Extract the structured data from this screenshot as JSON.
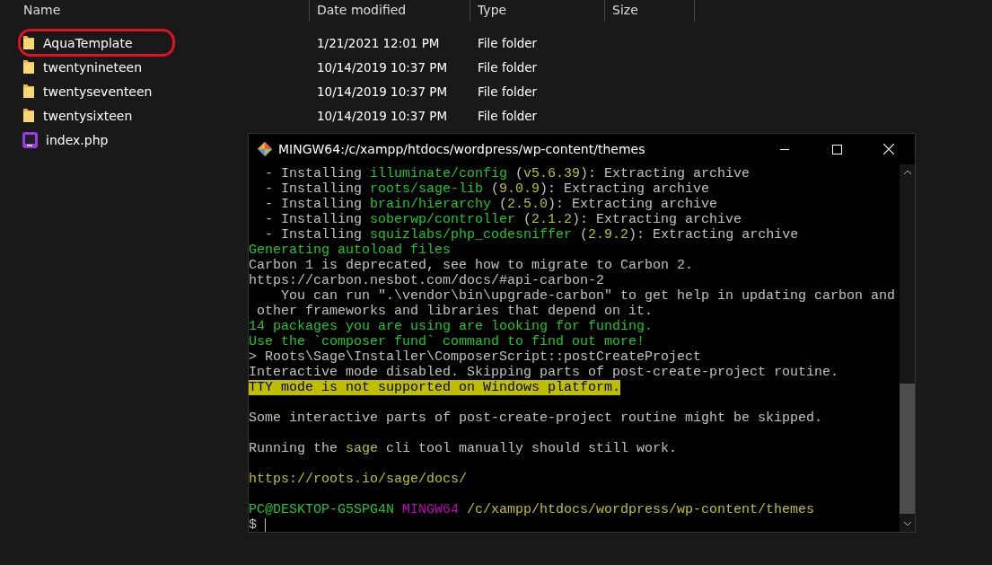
{
  "explorer": {
    "columns": [
      "Name",
      "Date modified",
      "Type",
      "Size"
    ],
    "rows": [
      {
        "name": "AquaTemplate",
        "date": "1/21/2021 12:01 PM",
        "type": "File folder",
        "kind": "folder",
        "circled": true
      },
      {
        "name": "twentynineteen",
        "date": "10/14/2019 10:37 PM",
        "type": "File folder",
        "kind": "folder",
        "circled": false
      },
      {
        "name": "twentyseventeen",
        "date": "10/14/2019 10:37 PM",
        "type": "File folder",
        "kind": "folder",
        "circled": false
      },
      {
        "name": "twentysixteen",
        "date": "10/14/2019 10:37 PM",
        "type": "File folder",
        "kind": "folder",
        "circled": false
      },
      {
        "name": "index.php",
        "kind": "php",
        "circled": false
      }
    ]
  },
  "terminal": {
    "title": "MINGW64:/c/xampp/htdocs/wordpress/wp-content/themes",
    "lines": [
      {
        "kind": "text",
        "segments": [
          {
            "kind": "plain",
            "text": "  - Installing "
          },
          {
            "kind": "green",
            "text": "illuminate/config"
          },
          {
            "kind": "plain",
            "text": " ("
          },
          {
            "kind": "yellow",
            "text": "v5.6.39"
          },
          {
            "kind": "plain",
            "text": "): Extracting archive"
          }
        ]
      },
      {
        "kind": "text",
        "segments": [
          {
            "kind": "plain",
            "text": "  - Installing "
          },
          {
            "kind": "green",
            "text": "roots/sage-lib"
          },
          {
            "kind": "plain",
            "text": " ("
          },
          {
            "kind": "yellow",
            "text": "9.0.9"
          },
          {
            "kind": "plain",
            "text": "): Extracting archive"
          }
        ]
      },
      {
        "kind": "text",
        "segments": [
          {
            "kind": "plain",
            "text": "  - Installing "
          },
          {
            "kind": "green",
            "text": "brain/hierarchy"
          },
          {
            "kind": "plain",
            "text": " ("
          },
          {
            "kind": "yellow",
            "text": "2.5.0"
          },
          {
            "kind": "plain",
            "text": "): Extracting archive"
          }
        ]
      },
      {
        "kind": "text",
        "segments": [
          {
            "kind": "plain",
            "text": "  - Installing "
          },
          {
            "kind": "green",
            "text": "soberwp/controller"
          },
          {
            "kind": "plain",
            "text": " ("
          },
          {
            "kind": "yellow",
            "text": "2.1.2"
          },
          {
            "kind": "plain",
            "text": "): Extracting archive"
          }
        ]
      },
      {
        "kind": "text",
        "segments": [
          {
            "kind": "plain",
            "text": "  - Installing "
          },
          {
            "kind": "green",
            "text": "squizlabs/php_codesniffer"
          },
          {
            "kind": "plain",
            "text": " ("
          },
          {
            "kind": "yellow",
            "text": "2.9.2"
          },
          {
            "kind": "plain",
            "text": "): Extracting archive"
          }
        ]
      },
      {
        "kind": "text",
        "segments": [
          {
            "kind": "green",
            "text": "Generating autoload files"
          }
        ]
      },
      {
        "kind": "text",
        "segments": [
          {
            "kind": "plain",
            "text": "Carbon 1 is deprecated, see how to migrate to Carbon 2."
          }
        ]
      },
      {
        "kind": "text",
        "segments": [
          {
            "kind": "plain",
            "text": "https://carbon.nesbot.com/docs/#api-carbon-2"
          }
        ]
      },
      {
        "kind": "text",
        "segments": [
          {
            "kind": "plain",
            "text": "    You can run \".\\vendor\\bin\\upgrade-carbon\" to get help in updating carbon and"
          }
        ]
      },
      {
        "kind": "text",
        "segments": [
          {
            "kind": "plain",
            "text": " other frameworks and libraries that depend on it."
          }
        ]
      },
      {
        "kind": "text",
        "segments": [
          {
            "kind": "green",
            "text": "14 packages you are using are looking for funding."
          }
        ]
      },
      {
        "kind": "text",
        "segments": [
          {
            "kind": "green",
            "text": "Use the `composer fund` command to find out more!"
          }
        ]
      },
      {
        "kind": "text",
        "segments": [
          {
            "kind": "plain",
            "text": "> Roots\\Sage\\Installer\\ComposerScript::postCreateProject"
          }
        ]
      },
      {
        "kind": "text",
        "segments": [
          {
            "kind": "plain",
            "text": "Interactive mode disabled. Skipping parts of post-create-project routine."
          }
        ]
      },
      {
        "kind": "text",
        "segments": [
          {
            "kind": "highlight",
            "text": "TTY mode is not supported on Windows platform."
          }
        ]
      },
      {
        "kind": "blank"
      },
      {
        "kind": "text",
        "segments": [
          {
            "kind": "plain",
            "text": "Some interactive parts of post-create-project routine might be skipped."
          }
        ]
      },
      {
        "kind": "blank"
      },
      {
        "kind": "text",
        "segments": [
          {
            "kind": "plain",
            "text": "Running the "
          },
          {
            "kind": "yellow",
            "text": "sage"
          },
          {
            "kind": "plain",
            "text": " cli tool manually should still work."
          }
        ]
      },
      {
        "kind": "blank"
      },
      {
        "kind": "text",
        "segments": [
          {
            "kind": "yellow",
            "text": "https://roots.io/sage/docs/"
          }
        ]
      },
      {
        "kind": "blank"
      },
      {
        "kind": "text",
        "segments": [
          {
            "kind": "green",
            "text": "PC@DESKTOP-G5SPG4N"
          },
          {
            "kind": "magenta",
            "text": " MINGW64"
          },
          {
            "kind": "yellow",
            "text": " /c/xampp/htdocs/wordpress/wp-content/themes"
          }
        ]
      },
      {
        "kind": "prompt",
        "segments": [
          {
            "kind": "plain",
            "text": "$ "
          }
        ]
      }
    ]
  }
}
